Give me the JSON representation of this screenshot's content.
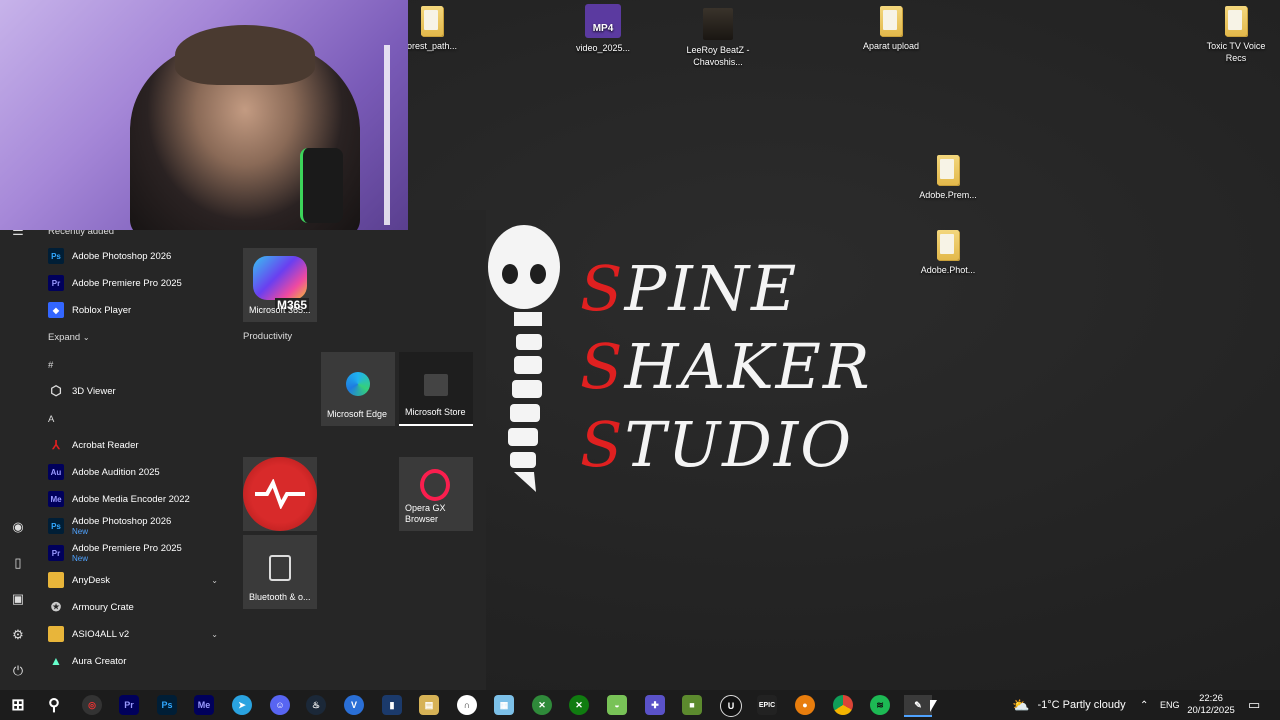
{
  "desktop": {
    "icons": [
      {
        "label": "orest_path...",
        "type": "folder"
      },
      {
        "label": "video_2025...",
        "type": "mp4",
        "badge": "MP4"
      },
      {
        "label": "LeeRoy BeatZ - Chavoshis...",
        "type": "album"
      },
      {
        "label": "Aparat upload",
        "type": "folder"
      },
      {
        "label": "Toxic TV Voice Recs",
        "type": "folder"
      },
      {
        "label": "Adobe.Prem...",
        "type": "folder"
      },
      {
        "label": "Adobe.Phot...",
        "type": "folder"
      }
    ],
    "wallpaper_lines": [
      [
        "S",
        "PINE"
      ],
      [
        "S",
        "HAKER"
      ],
      [
        "S",
        "TUDIO"
      ]
    ]
  },
  "start_menu": {
    "recently_added_label": "Recently added",
    "recent": [
      {
        "label": "Adobe Photoshop 2026",
        "icon": "Ps"
      },
      {
        "label": "Adobe Premiere Pro 2025",
        "icon": "Pr"
      },
      {
        "label": "Roblox Player",
        "icon": "roblox"
      }
    ],
    "expand_label": "Expand",
    "hash_label": "#",
    "a_label": "A",
    "apps": [
      {
        "label": "3D Viewer",
        "icon": "cube"
      },
      {
        "label": "Acrobat Reader",
        "icon": "acrobat"
      },
      {
        "label": "Adobe Audition 2025",
        "icon": "Au"
      },
      {
        "label": "Adobe Media Encoder 2022",
        "icon": "Me"
      },
      {
        "label": "Adobe Photoshop 2026",
        "icon": "Ps",
        "sub": "New"
      },
      {
        "label": "Adobe Premiere Pro 2025",
        "icon": "Pr",
        "sub": "New"
      },
      {
        "label": "AnyDesk",
        "icon": "folder"
      },
      {
        "label": "Armoury Crate",
        "icon": "armoury"
      },
      {
        "label": "ASIO4ALL v2",
        "icon": "folder"
      },
      {
        "label": "Aura Creator",
        "icon": "aura"
      }
    ],
    "tiles": {
      "m365_label": "Microsoft 365...",
      "m365_badge": "M365",
      "productivity_label": "Productivity",
      "edge_label": "Microsoft Edge",
      "store_label": "Microsoft Store",
      "opera_label": "Opera GX Browser",
      "bluetooth_label": "Bluetooth & o..."
    }
  },
  "taskbar": {
    "apps": [
      "windows",
      "search",
      "aura",
      "Pr",
      "Ps",
      "Me",
      "telegram",
      "discord",
      "steam",
      "v",
      "chart",
      "file",
      "headphones",
      "map",
      "xbox-edge",
      "xbox",
      "android",
      "gamepad",
      "minecraft",
      "unreal",
      "epic",
      "blender",
      "chrome",
      "spotify",
      "pen"
    ],
    "weather": "-1°C  Partly cloudy",
    "lang": "ENG",
    "time": "22:26",
    "date": "20/12/2025"
  }
}
